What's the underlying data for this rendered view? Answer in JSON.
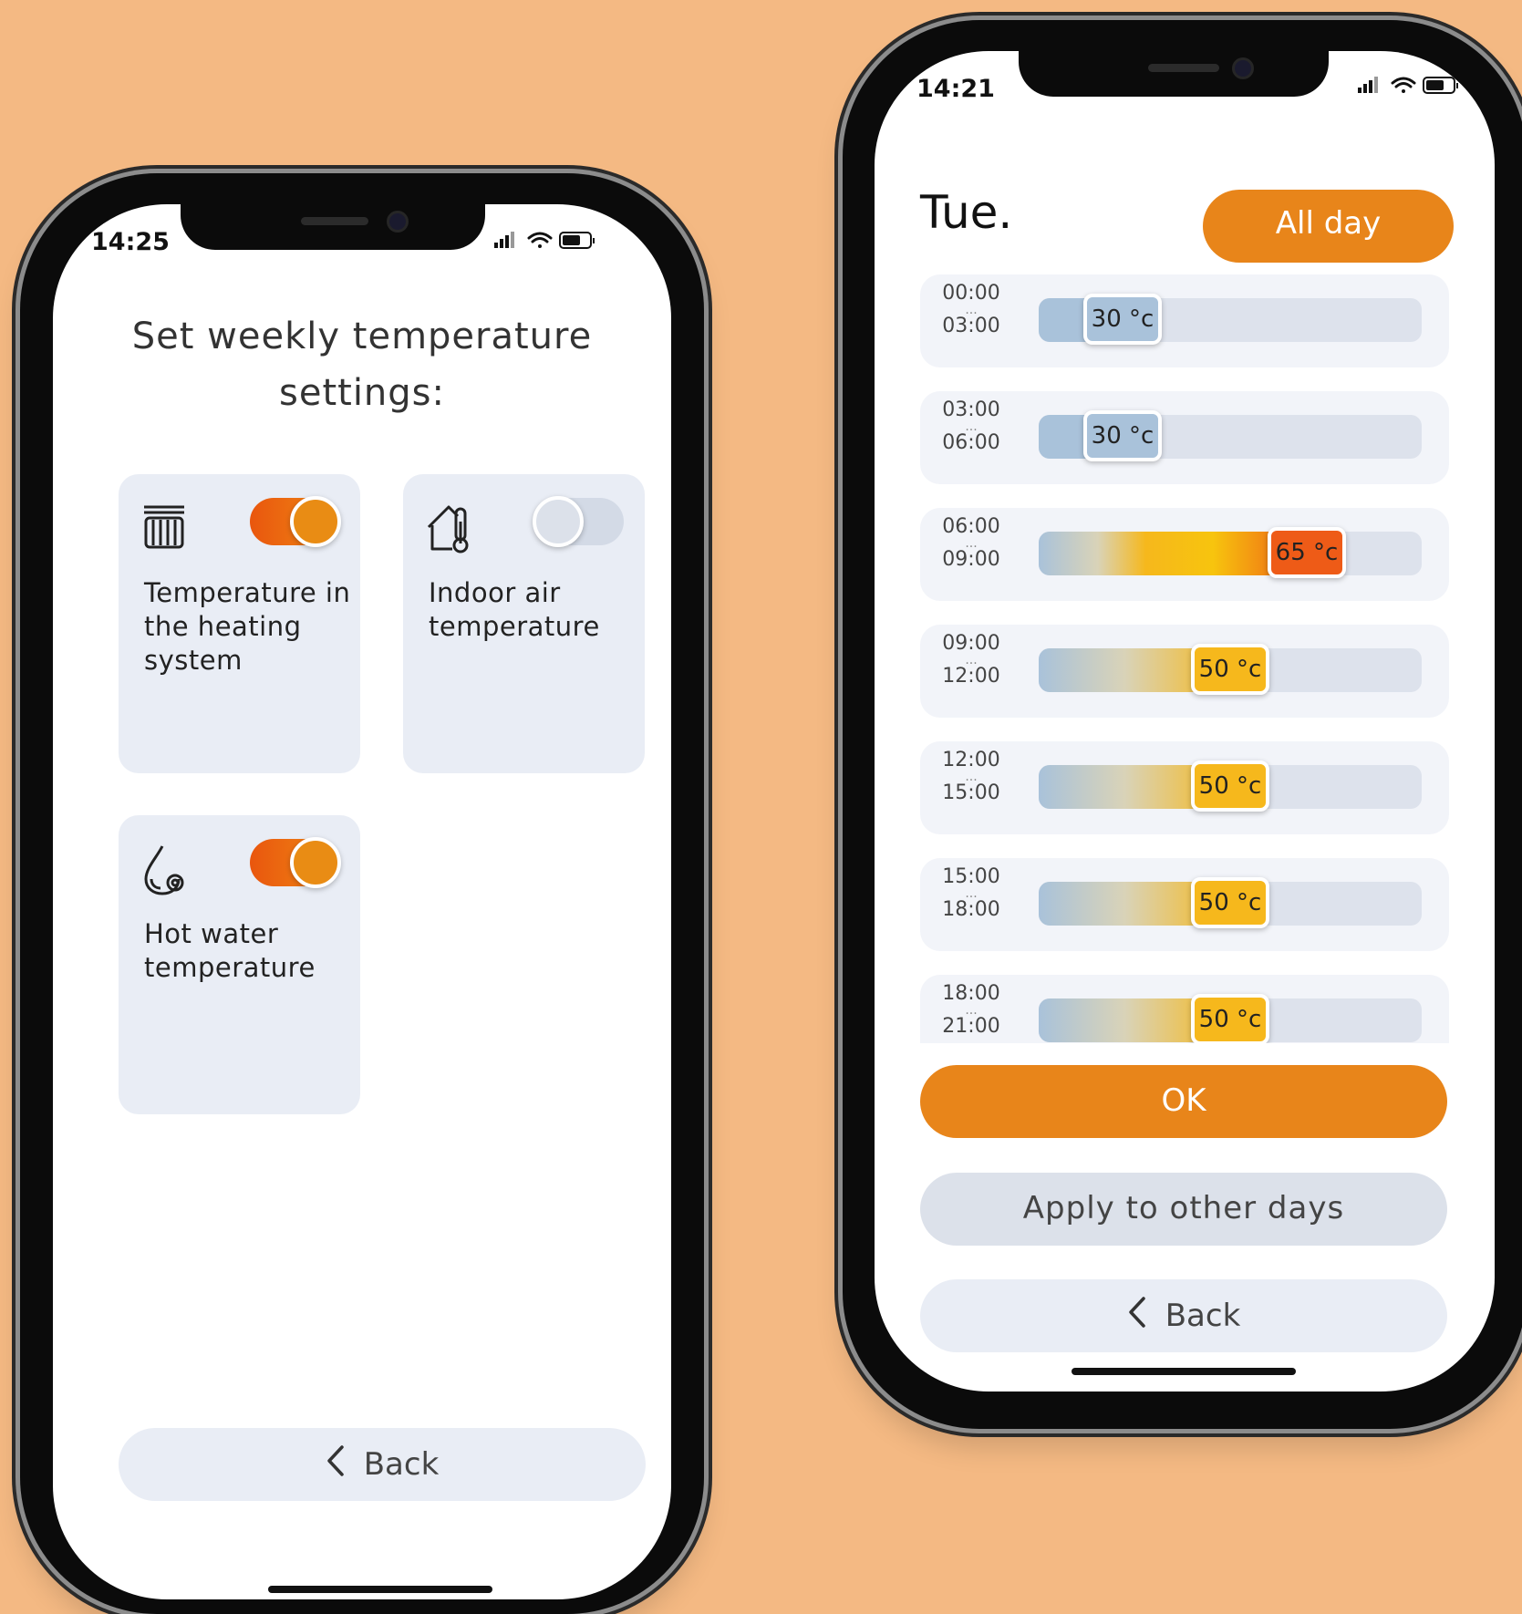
{
  "left_phone": {
    "status_time": "14:25",
    "title_line1": "Set weekly temperature",
    "title_line2": "settings:",
    "cards": [
      {
        "label": "Temperature in the heating system",
        "icon": "radiator-icon",
        "enabled": true
      },
      {
        "label": "Indoor air temperature",
        "icon": "house-thermometer-icon",
        "enabled": false
      },
      {
        "label": "Hot water temperature",
        "icon": "water-drop-icon",
        "enabled": true
      }
    ],
    "back_label": "Back"
  },
  "right_phone": {
    "status_time": "14:21",
    "day": "Tue.",
    "all_day_label": "All day",
    "slots": [
      {
        "start": "00:00",
        "sep": "...",
        "end": "03:00",
        "temp": "30 °c",
        "level": 0.22
      },
      {
        "start": "03:00",
        "sep": "...",
        "end": "06:00",
        "temp": "30 °c",
        "level": 0.22
      },
      {
        "start": "06:00",
        "sep": "...",
        "end": "09:00",
        "temp": "65 °c",
        "level": 0.7
      },
      {
        "start": "09:00",
        "sep": "...",
        "end": "12:00",
        "temp": "50 °c",
        "level": 0.5
      },
      {
        "start": "12:00",
        "sep": "...",
        "end": "15:00",
        "temp": "50 °c",
        "level": 0.5
      },
      {
        "start": "15:00",
        "sep": "...",
        "end": "18:00",
        "temp": "50 °c",
        "level": 0.5
      },
      {
        "start": "18:00",
        "sep": "...",
        "end": "21:00",
        "temp": "50 °c",
        "level": 0.5
      }
    ],
    "ok_label": "OK",
    "apply_label": "Apply to other days",
    "back_label": "Back"
  },
  "colors": {
    "background": "#F4B983",
    "accent_orange": "#E8851A",
    "hot_red": "#EE5B17",
    "warm_yellow": "#F6B81C",
    "cool_blue": "#A9C2DA",
    "card_bg": "#E9EDF5"
  }
}
